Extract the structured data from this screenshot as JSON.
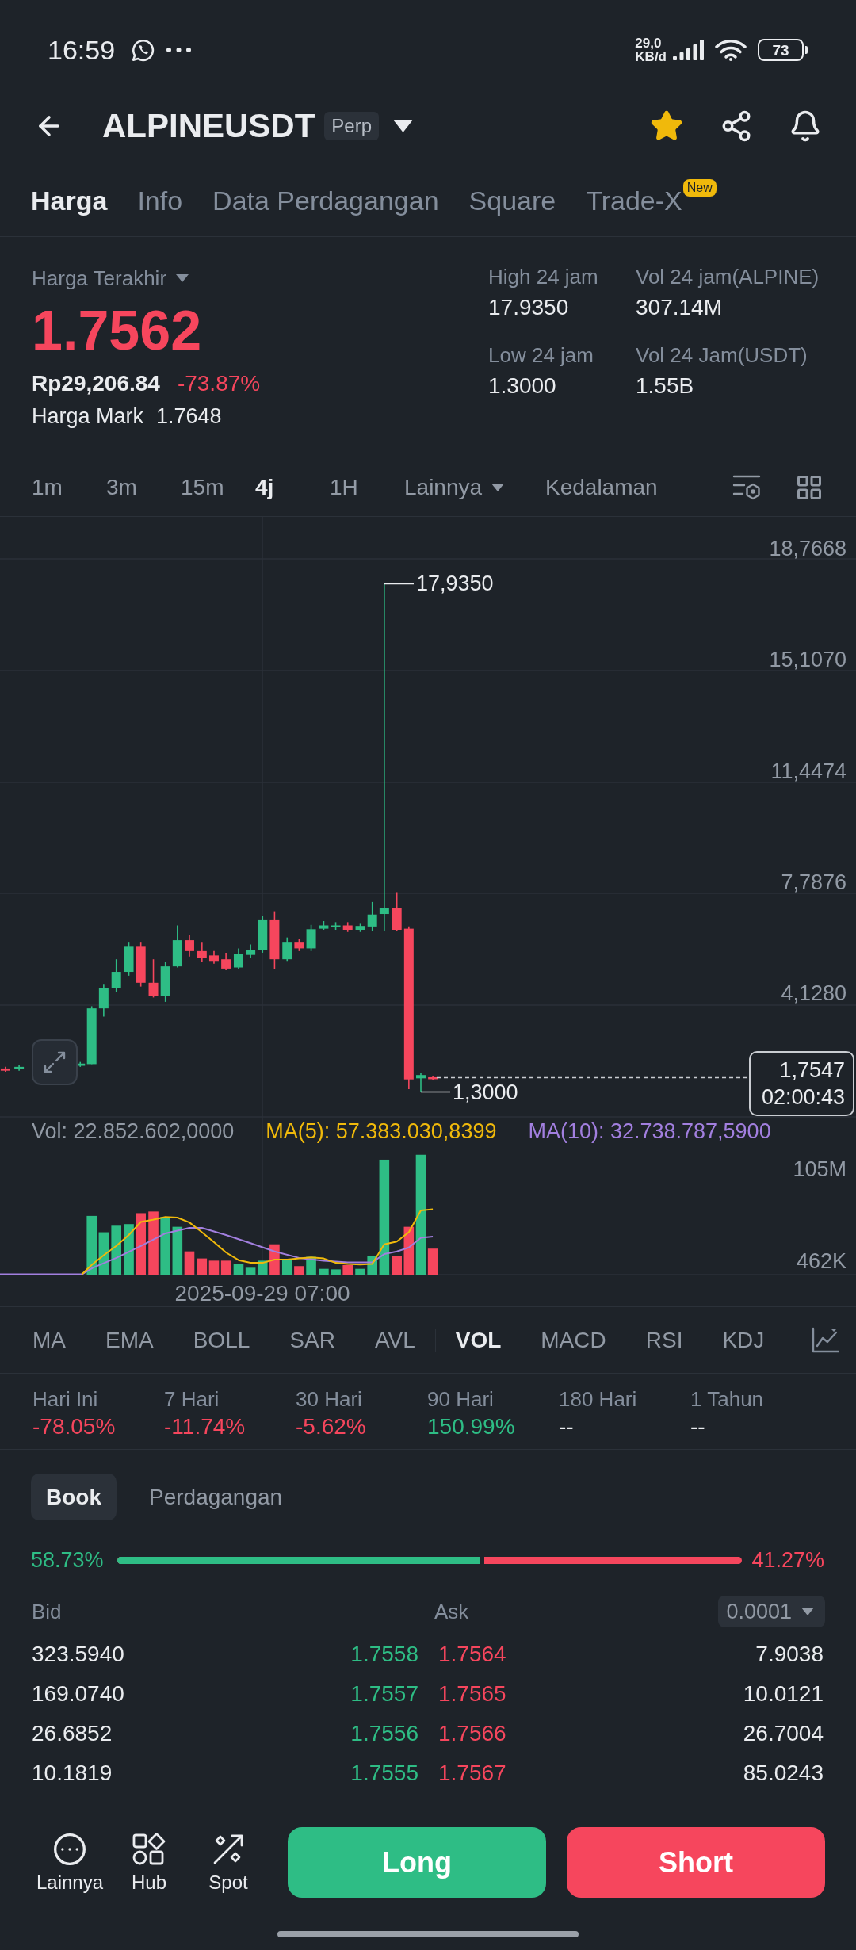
{
  "status_bar": {
    "time": "16:59",
    "network_speed_value": "29,0",
    "network_speed_unit": "KB/d",
    "battery": "73"
  },
  "header": {
    "symbol": "ALPINEUSDT",
    "badge": "Perp",
    "favorite": true
  },
  "tabs": [
    {
      "label": "Harga",
      "selected": true
    },
    {
      "label": "Info",
      "selected": false
    },
    {
      "label": "Data Perdagangan",
      "selected": false
    },
    {
      "label": "Square",
      "selected": false
    },
    {
      "label": "Trade-X",
      "selected": false,
      "badge": "New"
    }
  ],
  "price_summary": {
    "label": "Harga Terakhir",
    "last_price": "1.7562",
    "fiat_price": "Rp29,206.84",
    "change": "-73.87%",
    "mark_label": "Harga Mark",
    "mark_price": "1.7648"
  },
  "stats": [
    {
      "label": "High 24 jam",
      "value": "17.9350"
    },
    {
      "label": "Vol 24 jam(ALPINE)",
      "value": "307.14M"
    },
    {
      "label": "Low 24 jam",
      "value": "1.3000"
    },
    {
      "label": "Vol 24 Jam(USDT)",
      "value": "1.55B"
    }
  ],
  "intervals": [
    {
      "label": "1m",
      "kind": "interval",
      "selected": false
    },
    {
      "label": "3m",
      "kind": "interval",
      "selected": false
    },
    {
      "label": "15m",
      "kind": "interval",
      "selected": false
    },
    {
      "label": "4j",
      "kind": "interval",
      "selected": true
    },
    {
      "label": "1H",
      "kind": "interval",
      "selected": false
    },
    {
      "label": "Lainnya",
      "kind": "dropdown",
      "selected": false
    },
    {
      "label": "Kedalaman",
      "kind": "view",
      "selected": false
    }
  ],
  "chart": {
    "price_axis": [
      "18,7668",
      "15,1070",
      "11,4474",
      "7,7876",
      "4,1280"
    ],
    "high_marker": "17,9350",
    "low_marker": "1,3000",
    "last_price": "1,7547",
    "countdown": "02:00:43",
    "volume_legend": [
      {
        "text": "Vol: 22.852.602,0000",
        "kind": "vol"
      },
      {
        "text": "MA(5): 57.383.030,8399",
        "kind": "ma5"
      },
      {
        "text": "MA(10): 32.738.787,5900",
        "kind": "ma10"
      }
    ],
    "volume_axis": [
      "105M",
      "462K"
    ],
    "time_label": "2025-09-29 07:00"
  },
  "indicators": {
    "main": [
      {
        "label": "MA",
        "selected": false
      },
      {
        "label": "EMA",
        "selected": false
      },
      {
        "label": "BOLL",
        "selected": false
      },
      {
        "label": "SAR",
        "selected": false
      },
      {
        "label": "AVL",
        "selected": false
      }
    ],
    "sub": [
      {
        "label": "VOL",
        "selected": true
      },
      {
        "label": "MACD",
        "selected": false
      },
      {
        "label": "RSI",
        "selected": false
      },
      {
        "label": "KDJ",
        "selected": false
      }
    ]
  },
  "performance": [
    {
      "label": "Hari Ini",
      "value": "-78.05%",
      "kind": "down"
    },
    {
      "label": "7 Hari",
      "value": "-11.74%",
      "kind": "down"
    },
    {
      "label": "30 Hari",
      "value": "-5.62%",
      "kind": "down"
    },
    {
      "label": "90 Hari",
      "value": "150.99%",
      "kind": "up"
    },
    {
      "label": "180 Hari",
      "value": "--",
      "kind": "flat"
    },
    {
      "label": "1 Tahun",
      "value": "--",
      "kind": "flat"
    }
  ],
  "book_tabs": [
    {
      "label": "Book",
      "selected": true
    },
    {
      "label": "Perdagangan",
      "selected": false
    }
  ],
  "book_ratio": {
    "bid": "58.73%",
    "ask": "41.27%",
    "level": 0.5873
  },
  "order_book": {
    "bid_header": "Bid",
    "ask_header": "Ask",
    "precision": "0.0001",
    "rows": [
      {
        "bid_amount": "323.5940",
        "bid_price": "1.7558",
        "ask_price": "1.7564",
        "ask_amount": "7.9038"
      },
      {
        "bid_amount": "169.0740",
        "bid_price": "1.7557",
        "ask_price": "1.7565",
        "ask_amount": "10.0121"
      },
      {
        "bid_amount": "26.6852",
        "bid_price": "1.7556",
        "ask_price": "1.7566",
        "ask_amount": "26.7004"
      },
      {
        "bid_amount": "10.1819",
        "bid_price": "1.7555",
        "ask_price": "1.7567",
        "ask_amount": "85.0243"
      }
    ]
  },
  "bottom_bar": {
    "nav": [
      {
        "label": "Lainnya",
        "kind": "more"
      },
      {
        "label": "Hub",
        "kind": "hub"
      },
      {
        "label": "Spot",
        "kind": "spot"
      }
    ],
    "actions": [
      {
        "label": "Long",
        "kind": "long"
      },
      {
        "label": "Short",
        "kind": "short"
      }
    ]
  }
}
